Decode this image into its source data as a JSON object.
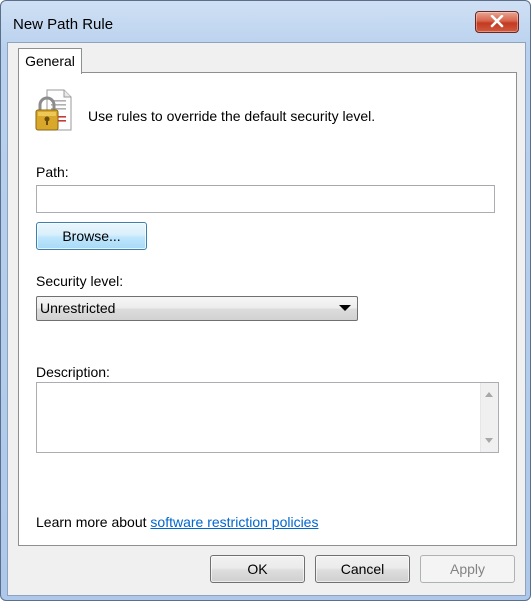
{
  "window": {
    "title": "New Path Rule"
  },
  "tabs": [
    {
      "label": "General"
    }
  ],
  "intro_text": "Use rules to override the default security level.",
  "path": {
    "label": "Path:",
    "value": "",
    "browse_label": "Browse..."
  },
  "security": {
    "label": "Security level:",
    "selected": "Unrestricted"
  },
  "description": {
    "label": "Description:",
    "value": ""
  },
  "learn_more": {
    "prefix": "Learn more about ",
    "link_text": "software restriction policies"
  },
  "buttons": {
    "ok": "OK",
    "cancel": "Cancel",
    "apply": "Apply"
  },
  "icons": {
    "close": "close-icon",
    "policy": "lock-document-icon"
  },
  "colors": {
    "link": "#0066cc",
    "close_red": "#c23a22",
    "focus_blue": "#3c7fb1"
  }
}
